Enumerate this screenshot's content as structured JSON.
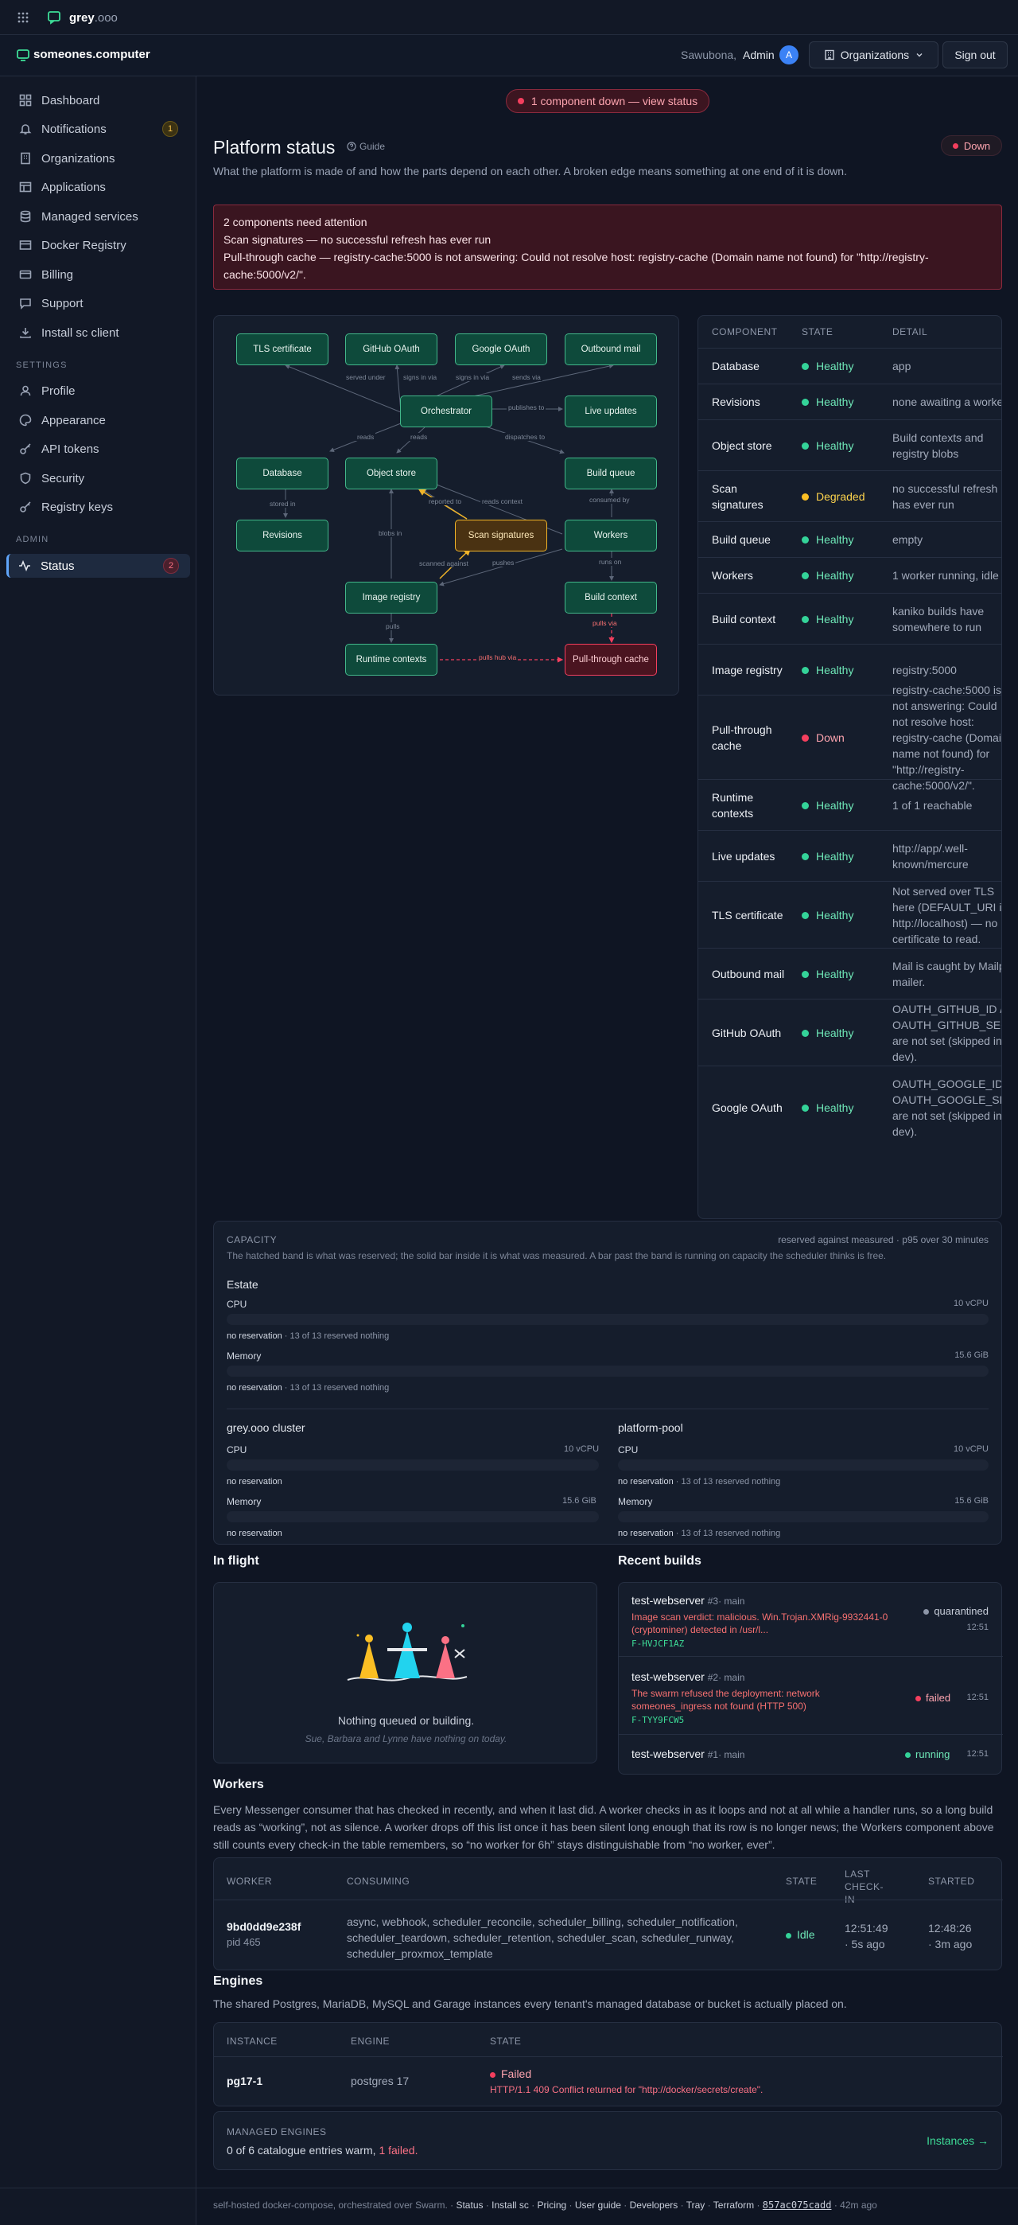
{
  "topbar": {
    "brand": "grey",
    "brand_suffix": ".ooo"
  },
  "header": {
    "logo": "someones.computer",
    "greeting": "Sawubona,",
    "user": "Admin",
    "avatar": "A",
    "org_button": "Organizations",
    "signout": "Sign out"
  },
  "sidebar": {
    "items": [
      {
        "label": "Dashboard",
        "icon": "grid-icon"
      },
      {
        "label": "Notifications",
        "icon": "bell-icon",
        "badge": "1"
      },
      {
        "label": "Organizations",
        "icon": "building-icon"
      },
      {
        "label": "Applications",
        "icon": "apps-icon"
      },
      {
        "label": "Managed services",
        "icon": "database-icon"
      },
      {
        "label": "Docker Registry",
        "icon": "box-icon"
      },
      {
        "label": "Billing",
        "icon": "card-icon"
      },
      {
        "label": "Support",
        "icon": "chat-icon"
      },
      {
        "label": "Install sc client",
        "icon": "download-icon"
      }
    ],
    "settings_heading": "SETTINGS",
    "settings": [
      {
        "label": "Profile",
        "icon": "user-icon"
      },
      {
        "label": "Appearance",
        "icon": "palette-icon"
      },
      {
        "label": "API tokens",
        "icon": "key-icon"
      },
      {
        "label": "Security",
        "icon": "shield-icon"
      },
      {
        "label": "Registry keys",
        "icon": "key-icon"
      }
    ],
    "admin_heading": "ADMIN",
    "admin": [
      {
        "label": "Status",
        "icon": "pulse-icon",
        "badge": "2"
      }
    ]
  },
  "banner": "1 component down — view status",
  "page": {
    "title": "Platform status",
    "guide": "Guide",
    "status_badge": "Down",
    "subtitle": "What the platform is made of and how the parts depend on each other. A broken edge means something at one end of it is down."
  },
  "attention": {
    "title": "2 components need attention",
    "lines": [
      "Scan signatures — no successful refresh has ever run",
      "Pull-through cache — registry-cache:5000 is not answering: Could not resolve host: registry-cache (Domain name not found) for \"http://registry-cache:5000/v2/\"."
    ]
  },
  "graph": {
    "nodes": [
      "TLS certificate",
      "GitHub OAuth",
      "Google OAuth",
      "Outbound mail",
      "Orchestrator",
      "Live updates",
      "Database",
      "Object store",
      "Build queue",
      "Revisions",
      "Scan signatures",
      "Workers",
      "Image registry",
      "Build context",
      "Runtime contexts",
      "Pull-through cache"
    ],
    "edges": [
      "served under",
      "signs in via",
      "signs in via",
      "sends via",
      "publishes to",
      "reads",
      "reads",
      "dispatches to",
      "stored in",
      "blobs in",
      "reported to",
      "reads context",
      "consumed by",
      "scanned against",
      "pushes",
      "runs on",
      "pulls via",
      "pulls",
      "pulls hub via"
    ]
  },
  "components": {
    "headers": [
      "COMPONENT",
      "STATE",
      "DETAIL"
    ],
    "rows": [
      {
        "name": "Database",
        "state": "Healthy",
        "detail": "app"
      },
      {
        "name": "Revisions",
        "state": "Healthy",
        "detail": "none awaiting a worker"
      },
      {
        "name": "Object store",
        "state": "Healthy",
        "detail": "Build contexts and registry blobs"
      },
      {
        "name": "Scan signatures",
        "state": "Degraded",
        "detail": "no successful refresh has ever run"
      },
      {
        "name": "Build queue",
        "state": "Healthy",
        "detail": "empty"
      },
      {
        "name": "Workers",
        "state": "Healthy",
        "detail": "1 worker running, idle"
      },
      {
        "name": "Build context",
        "state": "Healthy",
        "detail": "kaniko builds have somewhere to run"
      },
      {
        "name": "Image registry",
        "state": "Healthy",
        "detail": "registry:5000"
      },
      {
        "name": "Pull-through cache",
        "state": "Down",
        "detail": "registry-cache:5000 is not answering: Could not resolve host: registry-cache (Domain name not found) for \"http://registry-cache:5000/v2/\"."
      },
      {
        "name": "Runtime contexts",
        "state": "Healthy",
        "detail": "1 of 1 reachable"
      },
      {
        "name": "Live updates",
        "state": "Healthy",
        "detail": "http://app/.well-known/mercure"
      },
      {
        "name": "TLS certificate",
        "state": "Healthy",
        "detail": "Not served over TLS here (DEFAULT_URI is http://localhost) — no certificate to read."
      },
      {
        "name": "Outbound mail",
        "state": "Healthy",
        "detail": "Mail is caught by Mailpit mailer."
      },
      {
        "name": "GitHub OAuth",
        "state": "Healthy",
        "detail": "OAUTH_GITHUB_ID / OAUTH_GITHUB_SECRET are not set (skipped in dev)."
      },
      {
        "name": "Google OAuth",
        "state": "Healthy",
        "detail": "OAUTH_GOOGLE_ID / OAUTH_GOOGLE_SECRET are not set (skipped in dev)."
      }
    ]
  },
  "capacity": {
    "title": "CAPACITY",
    "meta": "reserved against measured · p95 over 30 minutes",
    "desc": "The hatched band is what was reserved; the solid bar inside it is what was measured. A bar past the band is running on capacity the scheduler thinks is free.",
    "estate": {
      "title": "Estate",
      "cpu_label": "CPU",
      "cpu_total": "10 vCPU",
      "cpu_note": "no reservation",
      "cpu_sub": "· 13 of 13 reserved nothing",
      "mem_label": "Memory",
      "mem_total": "15.6 GiB",
      "mem_note": "no reservation",
      "mem_sub": "· 13 of 13 reserved nothing"
    },
    "cluster": {
      "title": "grey.ooo cluster",
      "cpu_label": "CPU",
      "cpu_total": "10 vCPU",
      "cpu_note": "no reservation",
      "mem_label": "Memory",
      "mem_total": "15.6 GiB",
      "mem_note": "no reservation"
    },
    "pool": {
      "title": "platform-pool",
      "cpu_label": "CPU",
      "cpu_total": "10 vCPU",
      "cpu_note": "no reservation",
      "cpu_sub": "· 13 of 13 reserved nothing",
      "mem_label": "Memory",
      "mem_total": "15.6 GiB",
      "mem_note": "no reservation",
      "mem_sub": "· 13 of 13 reserved nothing"
    }
  },
  "inflight": {
    "title": "In flight",
    "empty": "Nothing queued or building.",
    "sub": "Sue, Barbara and Lynne have nothing on today."
  },
  "builds": {
    "title": "Recent builds",
    "items": [
      {
        "name": "test-webserver",
        "num": "#3",
        "branch": "· main",
        "msg": "Image scan verdict: malicious. Win.Trojan.XMRig-9932441-0 (cryptominer) detected in /usr/l...",
        "code": "F-HVJCF1AZ",
        "state": "quarantined",
        "time": "12:51"
      },
      {
        "name": "test-webserver",
        "num": "#2",
        "branch": "· main",
        "msg": "The swarm refused the deployment: network someones_ingress not found (HTTP 500)",
        "code": "F-TYY9FCW5",
        "state": "failed",
        "time": "12:51"
      },
      {
        "name": "test-webserver",
        "num": "#1",
        "branch": "· main",
        "msg": "",
        "code": "",
        "state": "running",
        "time": "12:51"
      }
    ]
  },
  "workers": {
    "title": "Workers",
    "desc": "Every Messenger consumer that has checked in recently, and when it last did. A worker checks in as it loops and not at all while a handler runs, so a long build reads as “working”, not as silence. A worker drops off this list once it has been silent long enough that its row is no longer news; the Workers component above still counts every check-in the table remembers, so “no worker for 6h” stays distinguishable from “no worker, ever”.",
    "headers": [
      "WORKER",
      "CONSUMING",
      "STATE",
      "LAST CHECK-IN",
      "STARTED"
    ],
    "row": {
      "id": "9bd0dd9e238f",
      "pid": "pid 465",
      "consuming": "async, webhook, scheduler_reconcile, scheduler_billing, scheduler_notification, scheduler_teardown, scheduler_retention, scheduler_scan, scheduler_runway, scheduler_proxmox_template",
      "state": "Idle",
      "last": "12:51:49",
      "last_ago": "· 5s ago",
      "started": "12:48:26",
      "started_ago": "· 3m ago"
    }
  },
  "engines": {
    "title": "Engines",
    "desc": "The shared Postgres, MariaDB, MySQL and Garage instances every tenant's managed database or bucket is actually placed on.",
    "headers": [
      "INSTANCE",
      "ENGINE",
      "STATE"
    ],
    "row": {
      "instance": "pg17-1",
      "engine": "postgres 17",
      "state": "Failed",
      "error": "HTTP/1.1 409 Conflict returned for \"http://docker/secrets/create\"."
    },
    "managed_title": "MANAGED ENGINES",
    "managed_text": "0 of 6 catalogue entries warm,",
    "managed_failed": "1 failed.",
    "instances_link": "Instances →"
  },
  "footer": {
    "text": "self-hosted docker-compose, orchestrated over Swarm.",
    "links": [
      "Status",
      "Install sc",
      "Pricing",
      "User guide",
      "Developers",
      "Tray",
      "Terraform"
    ],
    "commit": "857ac075cadd",
    "ago": "· 42m ago"
  },
  "colors": {
    "healthy": "#34d399",
    "degraded": "#fbbf24",
    "down": "#f43f5e",
    "accent": "#3ddc97"
  }
}
